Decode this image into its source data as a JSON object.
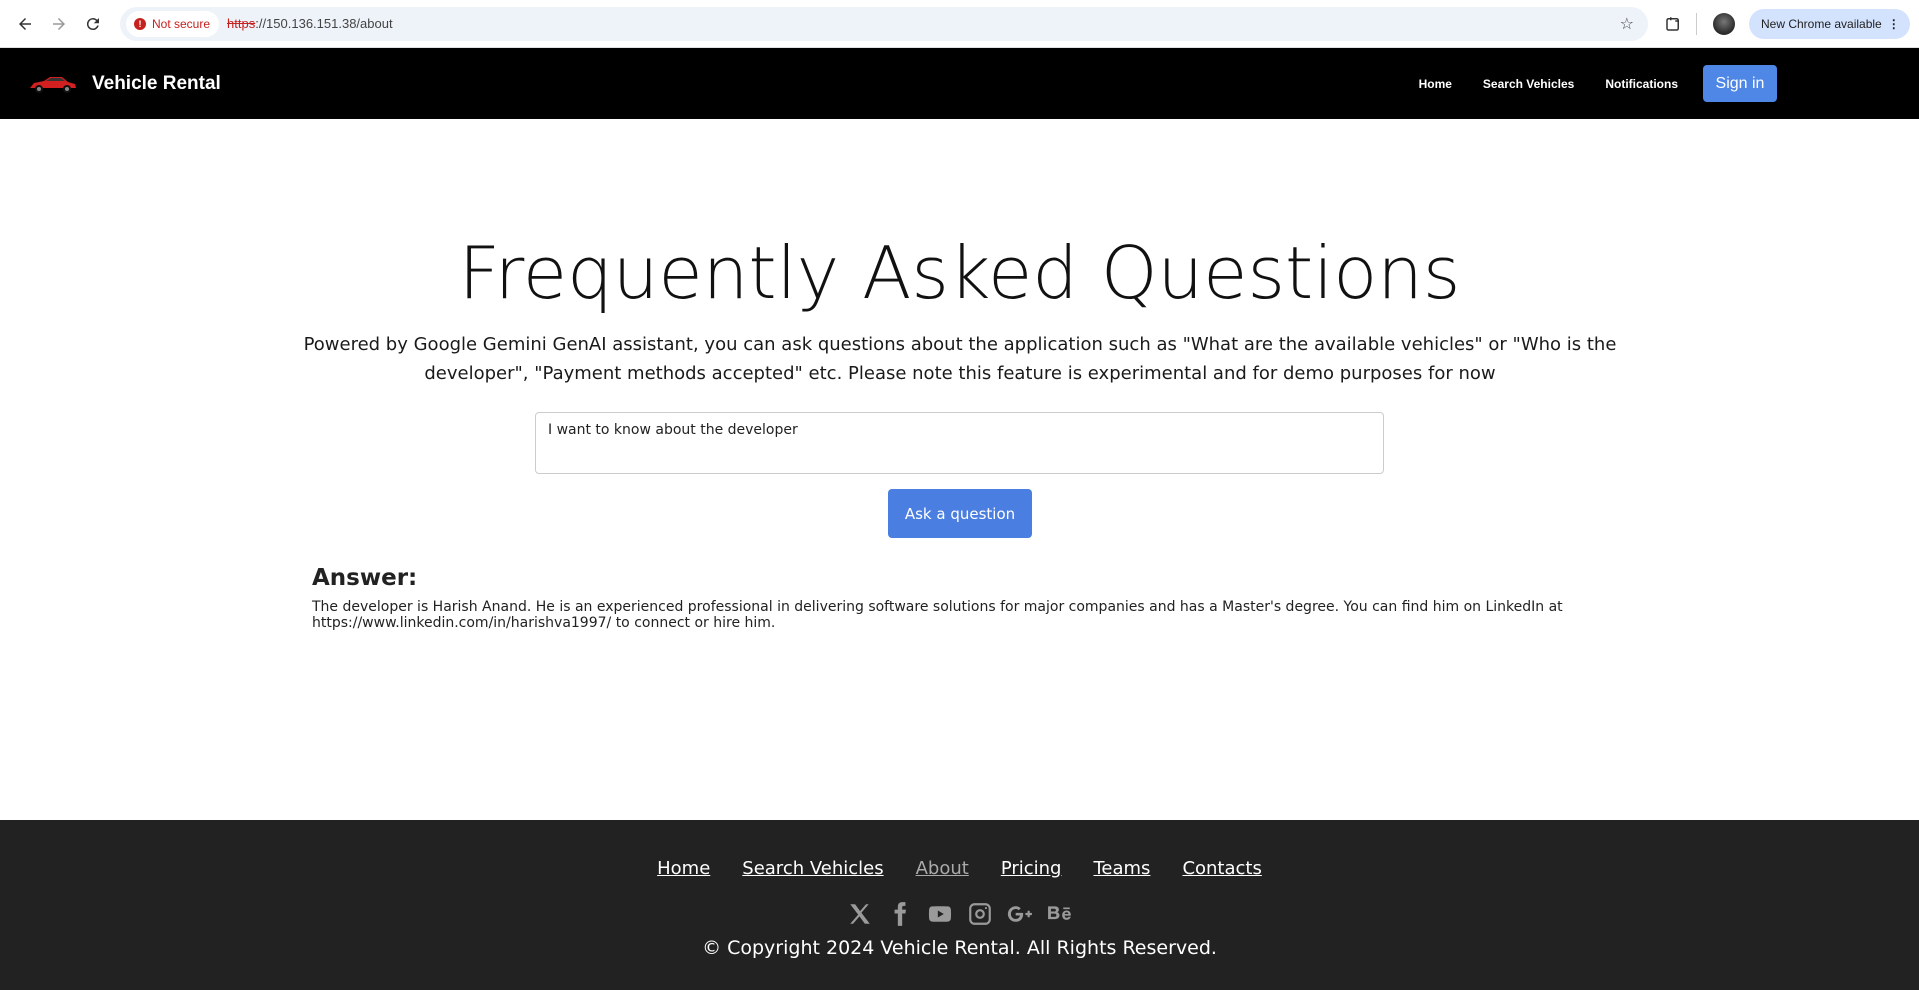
{
  "browser": {
    "security_label": "Not secure",
    "url_scheme": "https",
    "url_rest": "://150.136.151.38/about",
    "update_label": "New Chrome available",
    "kebab": "⋮"
  },
  "navbar": {
    "brand": "Vehicle Rental",
    "links": [
      "Home",
      "Search Vehicles",
      "Notifications"
    ],
    "signin_label": "Sign in",
    "accent_color": "#4f87e6"
  },
  "faq": {
    "title": "Frequently Asked Questions",
    "description": "Powered by Google Gemini GenAI assistant, you can ask questions about the application such as \"What are the available vehicles\" or \"Who is the developer\", \"Payment methods accepted\" etc. Please note this feature is experimental and for demo purposes for now",
    "question_value": "I want to know about the developer",
    "ask_label": "Ask a question",
    "answer_heading": "Answer:",
    "answer_text": "The developer is Harish Anand. He is an experienced professional in delivering software solutions for major companies and has a Master's degree. You can find him on LinkedIn at https://www.linkedin.com/in/harishva1997/ to connect or hire him."
  },
  "footer": {
    "links": [
      "Home",
      "Search Vehicles",
      "About",
      "Pricing",
      "Teams",
      "Contacts"
    ],
    "active_link": "About",
    "social_icons": [
      "x-icon",
      "facebook-icon",
      "youtube-icon",
      "instagram-icon",
      "google-plus-icon",
      "behance-icon"
    ],
    "copyright": "© Copyright 2024 Vehicle Rental. All Rights Reserved."
  }
}
